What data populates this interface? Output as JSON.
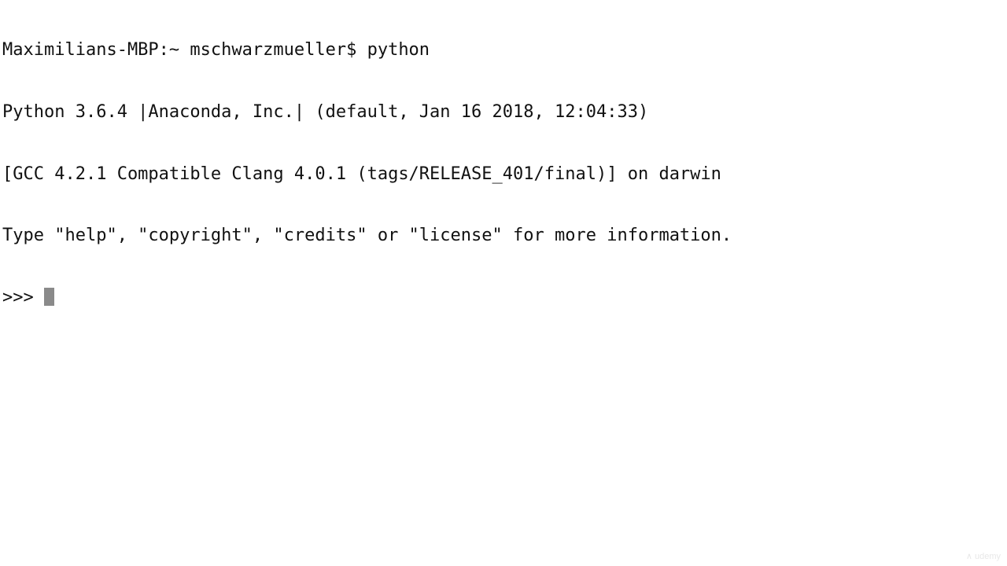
{
  "terminal": {
    "lines": [
      "Maximilians-MBP:~ mschwarzmueller$ python",
      "Python 3.6.4 |Anaconda, Inc.| (default, Jan 16 2018, 12:04:33)",
      "[GCC 4.2.1 Compatible Clang 4.0.1 (tags/RELEASE_401/final)] on darwin",
      "Type \"help\", \"copyright\", \"credits\" or \"license\" for more information."
    ],
    "prompt": ">>> ",
    "cursor_color": "#8a8a8a"
  },
  "watermark": {
    "text": "udemy"
  }
}
